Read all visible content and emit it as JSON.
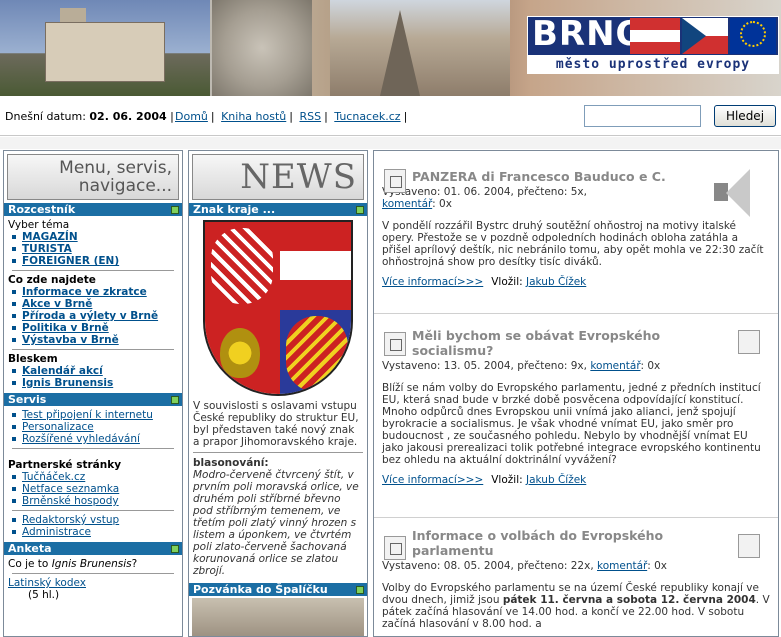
{
  "header": {
    "brand": "BRNO",
    "subtitle": "město uprostřed evropy"
  },
  "topbar": {
    "date_label": "Dnešní datum:",
    "date_value": "02. 06. 2004",
    "links": [
      "Domů",
      "Kniha hostů",
      "RSS",
      "Tucnacek.cz"
    ],
    "search_placeholder": "",
    "search_button": "Hledej"
  },
  "left": {
    "menu_image_label": "Menu, servis, navigace...",
    "rozcestnik": {
      "title": "Rozcestník",
      "intro": "Vyber téma",
      "topics": [
        "MAGAZÍN",
        "TURISTA",
        "FOREIGNER (EN)"
      ],
      "find_head": "Co zde najdete",
      "find": [
        "Informace ve zkratce",
        "Akce v Brně",
        "Příroda a výlety v Brně",
        "Politika v Brně",
        "Výstavba v Brně"
      ],
      "flash_head": "Bleskem",
      "flash": [
        "Kalendář akcí",
        "Ignis Brunensis"
      ]
    },
    "servis": {
      "title": "Servis",
      "links": [
        "Test připojení k internetu",
        "Personalizace",
        "Rozšířené vyhledávání"
      ],
      "partners_head": "Partnerské stránky",
      "partners": [
        "Tučňáček.cz",
        "Netface seznamka",
        "Brněnské hospody"
      ],
      "admin": [
        "Redaktorský vstup",
        "Administrace"
      ]
    },
    "anketa": {
      "title": "Anketa",
      "question_prefix": "Co je to",
      "question_em": "Ignis Brunensis",
      "question_suffix": "?",
      "option1": "Latinský kodex",
      "votes": "(5 hl.)"
    }
  },
  "middle": {
    "news_image_label": "NEWS",
    "znak_title": "Znak kraje ...",
    "znak_text": "V souvislosti s oslavami vstupu České republiky do struktur EU, byl představen také nový znak a prapor Jihomoravského kraje.",
    "blason_head": "blasonování:",
    "blason_text": "Modro-červeně čtvrcený štít, v prvním poli moravská orlice, ve druhém poli stříbrné břevno pod stříbrným temenem, ve třetím poli zlatý vinný hrozen s listem a úponkem, ve čtvrtém poli zlato-červeně šachovaná korunovaná orlice se zlatou zbrojí.",
    "pozvanka_title": "Pozvánka do Špalíčku"
  },
  "articles": [
    {
      "title": "PANZERA di Francesco Bauduco e C.",
      "meta_prefix": "Vystaveno: 01. 06. 2004, přečteno: 5x,",
      "comment_link": "komentář",
      "comment_count": ": 0x",
      "body": "V pondělí rozzářil Bystrc druhý soutěžní ohňostroj na motivy italské opery. Přestože se v pozdně odpoledních hodinách obloha zatáhla a přišel aprílový deštík, nic nebránilo tomu, aby opět mohla ve 22:30 začít ohňostrojná show pro desítky tisíc diváků.",
      "more": "Více informací>>>",
      "author_prefix": "Vložil:",
      "author": "Jakub Čížek"
    },
    {
      "title": "Měli bychom se obávat Evropského socialismu?",
      "meta_prefix": "Vystaveno: 13. 05. 2004, přečteno: 9x,",
      "comment_link": "komentář",
      "comment_count": ": 0x",
      "body": "Blíží se nám volby do Evropského parlamentu, jedné z předních institucí EU, která snad bude v brzké době posvěcena odpovídající konstitucí. Mnoho odpůrců dnes Evropskou unii vnímá jako alianci, jenž spojují byrokracie a socialismus. Je však vhodné vnímat EU, jako směr pro budoucnost , ze současného pohledu. Nebylo by vhodnější vnímat EU jako jakousi prerealizaci tolik potřebné integrace evropského kontinentu bez ohledu na aktuální doktrinální vyvážení?",
      "more": "Více informací>>>",
      "author_prefix": "Vložil:",
      "author": "Jakub Čížek"
    },
    {
      "title": "Informace o volbách do Evropského parlamentu",
      "meta_prefix": "Vystaveno: 08. 05. 2004, přečteno: 22x,",
      "comment_link": "komentář",
      "comment_count": ": 0x",
      "body_a": "Volby do Evropského parlamentu se na území České republiky konají ve dvou dnech, jimiž jsou ",
      "body_b": "pátek 11. června a sobota 12. června 2004",
      "body_c": ". V pátek začíná hlasování ve 14.00 hod. a končí ve 22.00 hod. V sobotu začíná hlasování v 8.00 hod. a"
    }
  ]
}
